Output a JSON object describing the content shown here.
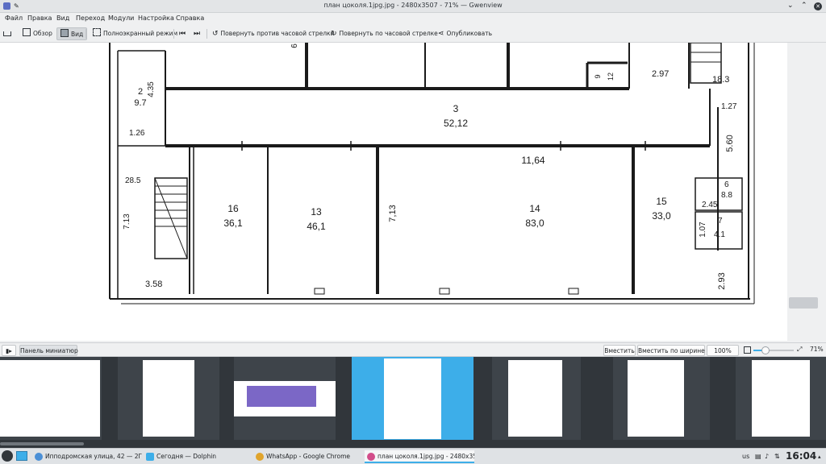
{
  "window": {
    "title": "план цоколя.1jpg.jpg - 2480x3507 - 71% — Gwenview"
  },
  "menu": [
    "Файл",
    "Правка",
    "Вид",
    "Переход",
    "Модули",
    "Настройка",
    "Справка"
  ],
  "toolbar": {
    "overview": "Обзор",
    "view": "Вид",
    "fullscreen": "Полноэкранный режим",
    "rotate_ccw": "Повернуть против часовой стрелки",
    "rotate_cw": "Повернуть по часовой стрелке",
    "share": "Опубликовать"
  },
  "floorplan": {
    "rooms": [
      {
        "num": "2",
        "area": "9.7"
      },
      {
        "num": "3",
        "area": "52,12"
      },
      {
        "num": "16",
        "area": "36,1"
      },
      {
        "num": "13",
        "area": "46,1"
      },
      {
        "num": "14",
        "area": "83,0"
      },
      {
        "num": "15",
        "area": "33,0"
      }
    ],
    "dims": {
      "d435": "4.35",
      "d126": "1.26",
      "d285": "28.5",
      "d713a": "7.13",
      "d358": "3.58",
      "d713b": "7,13",
      "d1164": "11,64",
      "d297": "2.97",
      "d183": "18.3",
      "d127": "1.27",
      "d560": "5.60",
      "d88": "8.8",
      "d245": "2.45",
      "d6": "6",
      "d7": "7",
      "d107": "1.07",
      "d41": "4.1",
      "d293": "2.93",
      "d9": "9",
      "d12": "12",
      "d6a": "6"
    }
  },
  "statusbar": {
    "thumbnail_panel": "Панель миниатюр",
    "fit": "Вместить",
    "fit_width": "Вместить по ширине",
    "zoom": "100%",
    "zoom_level": "71%",
    "zoom_fraction": 0.3
  },
  "taskbar": {
    "tasks": [
      "Ипподромская улица, 42 — 2ГИС",
      "Сегодня — Dolphin",
      "WhatsApp - Google Chrome",
      "план цоколя.1jpg.jpg - 2480x3507..."
    ],
    "lang": "us",
    "clock": "16:04"
  }
}
